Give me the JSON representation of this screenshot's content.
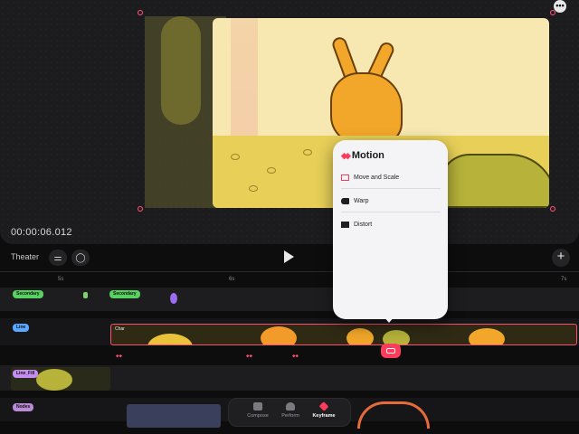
{
  "canvas": {
    "timecode": "00:00:06.012",
    "more_icon": "more-icon",
    "frame_color": "#f7e7b1"
  },
  "toolbar": {
    "theater_label": "Theater",
    "adjust_icon": "sliders-icon",
    "comment_icon": "speech-bubble-icon",
    "play_icon": "play-icon",
    "add_icon": "plus-icon"
  },
  "ruler": {
    "ticks": [
      "5s",
      "6s",
      "7s"
    ]
  },
  "tracks": [
    {
      "label": "Secondary",
      "color": "#58d062"
    },
    {
      "label": "Secondary",
      "color": "#58d062"
    },
    {
      "label": "Line",
      "color": "#5aa7ff"
    },
    {
      "label": "Line_Fill",
      "color": "#c58df0"
    },
    {
      "label": "Nodes",
      "color": "#b98ad6"
    }
  ],
  "clip": {
    "label": "Char",
    "selected_color": "#ff4f72"
  },
  "popover": {
    "title": "Motion",
    "items": [
      {
        "label": "Move and Scale",
        "icon": "move-scale-icon"
      },
      {
        "label": "Warp",
        "icon": "warp-icon"
      },
      {
        "label": "Distort",
        "icon": "distort-icon"
      }
    ]
  },
  "tabbar": {
    "tabs": [
      {
        "label": "Compose",
        "icon": "compose-icon"
      },
      {
        "label": "Perform",
        "icon": "perform-icon"
      },
      {
        "label": "Keyframe",
        "icon": "keyframe-icon",
        "active": true
      }
    ]
  },
  "colors": {
    "accent": "#ff3b5c",
    "background": "#0d0d0e"
  }
}
